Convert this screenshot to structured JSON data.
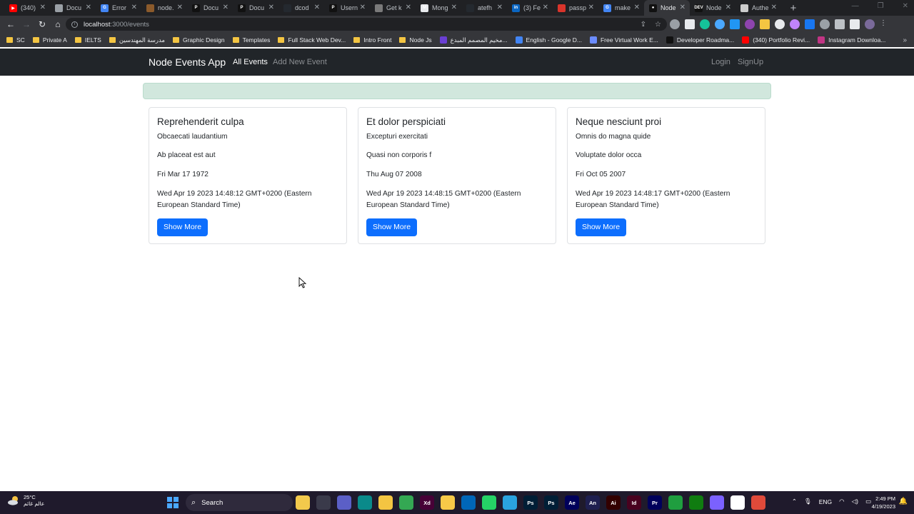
{
  "browser": {
    "tabs": [
      {
        "title": "(340)",
        "color": "#ff0000",
        "glyph": "▶",
        "active": false
      },
      {
        "title": "Docu",
        "color": "#9aa0a6",
        "glyph": "",
        "active": false
      },
      {
        "title": "Error",
        "color": "#4285f4",
        "glyph": "G",
        "active": false
      },
      {
        "title": "node.",
        "color": "#8b5a2b",
        "glyph": "",
        "active": false
      },
      {
        "title": "Docu",
        "color": "#111111",
        "glyph": "P",
        "active": false
      },
      {
        "title": "Docu",
        "color": "#111111",
        "glyph": "P",
        "active": false
      },
      {
        "title": "dcod",
        "color": "#24292f",
        "glyph": "",
        "active": false
      },
      {
        "title": "Usern",
        "color": "#111111",
        "glyph": "P",
        "active": false
      },
      {
        "title": "Get k",
        "color": "#7a7a7a",
        "glyph": "",
        "active": false
      },
      {
        "title": "Mong",
        "color": "#e8eaed",
        "glyph": "M",
        "active": false
      },
      {
        "title": "atefh",
        "color": "#24292f",
        "glyph": "",
        "active": false
      },
      {
        "title": "(3) Fe",
        "color": "#0a66c2",
        "glyph": "in",
        "active": false
      },
      {
        "title": "passp",
        "color": "#d9342b",
        "glyph": "",
        "active": false
      },
      {
        "title": "make",
        "color": "#4285f4",
        "glyph": "G",
        "active": false
      },
      {
        "title": "Node",
        "color": "#111111",
        "glyph": "●",
        "active": true
      },
      {
        "title": "Node",
        "color": "#111111",
        "glyph": "DEV",
        "active": false
      },
      {
        "title": "Authe",
        "color": "#cccccc",
        "glyph": "",
        "active": false
      }
    ],
    "new_tab": "+",
    "address": {
      "host": "localhost",
      "path": ":3000/events"
    },
    "bookmarks": [
      {
        "label": "SC",
        "type": "folder",
        "color": "#f4c542"
      },
      {
        "label": "Private A",
        "type": "folder",
        "color": "#f4c542"
      },
      {
        "label": "IELTS",
        "type": "folder",
        "color": "#f4c542"
      },
      {
        "label": "مدرسة المهندسين",
        "type": "folder",
        "color": "#f4c542"
      },
      {
        "label": "Graphic Design",
        "type": "folder",
        "color": "#f4c542"
      },
      {
        "label": "Templates",
        "type": "folder",
        "color": "#f4c542"
      },
      {
        "label": "Full Stack Web Dev...",
        "type": "folder",
        "color": "#f4c542"
      },
      {
        "label": "Intro Front",
        "type": "folder",
        "color": "#f4c542"
      },
      {
        "label": "Node Js",
        "type": "folder",
        "color": "#f4c542"
      },
      {
        "label": "مخيم المصمم المبدع...",
        "type": "site",
        "color": "#6a3fd3"
      },
      {
        "label": "English - Google D...",
        "type": "site",
        "color": "#4285f4"
      },
      {
        "label": "Free Virtual Work E...",
        "type": "site",
        "color": "#6b8cff"
      },
      {
        "label": "Developer Roadma...",
        "type": "site",
        "color": "#111111"
      },
      {
        "label": "(340) Portfolio Revi...",
        "type": "site",
        "color": "#ff0000"
      },
      {
        "label": "Instagram Downloa...",
        "type": "site",
        "color": "#c13584"
      }
    ]
  },
  "app": {
    "brand": "Node Events App",
    "nav": [
      {
        "label": "All Events",
        "active": true
      },
      {
        "label": "Add New Event",
        "active": false
      }
    ],
    "auth": [
      {
        "label": "Login"
      },
      {
        "label": "SignUp"
      }
    ],
    "alert_text": "",
    "events": [
      {
        "title": "Reprehenderit culpa",
        "description": "Obcaecati laudantium",
        "location": "Ab placeat est aut",
        "date": "Fri Mar 17 1972",
        "created_at": "Wed Apr 19 2023 14:48:12 GMT+0200 (Eastern European Standard Time)",
        "button": "Show More"
      },
      {
        "title": "Et dolor perspiciati",
        "description": "Excepturi exercitati",
        "location": "Quasi non corporis f",
        "date": "Thu Aug 07 2008",
        "created_at": "Wed Apr 19 2023 14:48:15 GMT+0200 (Eastern European Standard Time)",
        "button": "Show More"
      },
      {
        "title": "Neque nesciunt proi",
        "description": "Omnis do magna quide",
        "location": "Voluptate dolor occa",
        "date": "Fri Oct 05 2007",
        "created_at": "Wed Apr 19 2023 14:48:17 GMT+0200 (Eastern European Standard Time)",
        "button": "Show More"
      }
    ]
  },
  "taskbar": {
    "temperature": "25°C",
    "weather_note": "عالم غائم",
    "search": "Search",
    "apps": [
      {
        "name": "file-explorer",
        "label": "",
        "color": "#f2c94c"
      },
      {
        "name": "task-view",
        "label": "",
        "color": "#3a3a4a"
      },
      {
        "name": "teams",
        "label": "",
        "color": "#5b5fc7"
      },
      {
        "name": "edge",
        "label": "",
        "color": "#0a8a8a"
      },
      {
        "name": "folder",
        "label": "",
        "color": "#f4c542"
      },
      {
        "name": "chrome",
        "label": "",
        "color": "#34a853"
      },
      {
        "name": "xd",
        "label": "Xd",
        "color": "#470137"
      },
      {
        "name": "sticky-notes",
        "label": "",
        "color": "#f7c948"
      },
      {
        "name": "vscode",
        "label": "",
        "color": "#0066b8"
      },
      {
        "name": "whatsapp",
        "label": "",
        "color": "#25d366"
      },
      {
        "name": "telegram",
        "label": "",
        "color": "#2aa3df"
      },
      {
        "name": "photoshop-1",
        "label": "Ps",
        "color": "#001e36"
      },
      {
        "name": "photoshop-2",
        "label": "Ps",
        "color": "#001e36"
      },
      {
        "name": "after-effects",
        "label": "Ae",
        "color": "#00005b"
      },
      {
        "name": "animate",
        "label": "An",
        "color": "#1f1f50"
      },
      {
        "name": "illustrator",
        "label": "Ai",
        "color": "#330000"
      },
      {
        "name": "indesign",
        "label": "Id",
        "color": "#49021f"
      },
      {
        "name": "premiere",
        "label": "Pr",
        "color": "#00005b"
      },
      {
        "name": "camtasia",
        "label": "",
        "color": "#1f9e3f"
      },
      {
        "name": "xbox",
        "label": "",
        "color": "#107c10"
      },
      {
        "name": "app-purple",
        "label": "",
        "color": "#7b61ff"
      },
      {
        "name": "app-white",
        "label": "",
        "color": "#ffffff"
      },
      {
        "name": "app-red",
        "label": "",
        "color": "#e04a3a"
      }
    ],
    "language": "ENG",
    "time": "2:49 PM",
    "date": "4/19/2023"
  }
}
